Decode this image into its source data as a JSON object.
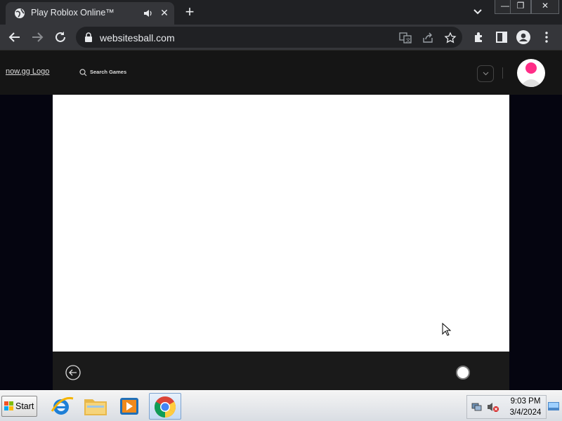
{
  "browser": {
    "tab": {
      "title": "Play Roblox Online™",
      "close_label": "✕"
    },
    "new_tab_label": "+",
    "window_controls": {
      "minimize": "—",
      "restore": "❐",
      "close": "✕"
    },
    "url": "websitesball.com"
  },
  "site": {
    "logo_alt": "now.gg Logo",
    "search_label": "Search Games",
    "avatar_color": "#ff2d87"
  },
  "taskbar": {
    "start_label": "Start",
    "time": "9:03 PM",
    "date": "3/4/2024"
  },
  "colors": {
    "tab_bg": "#35363a",
    "tabstrip_bg": "#202124",
    "site_header_bg": "#151515",
    "game_frame_bg": "#ffffff"
  }
}
